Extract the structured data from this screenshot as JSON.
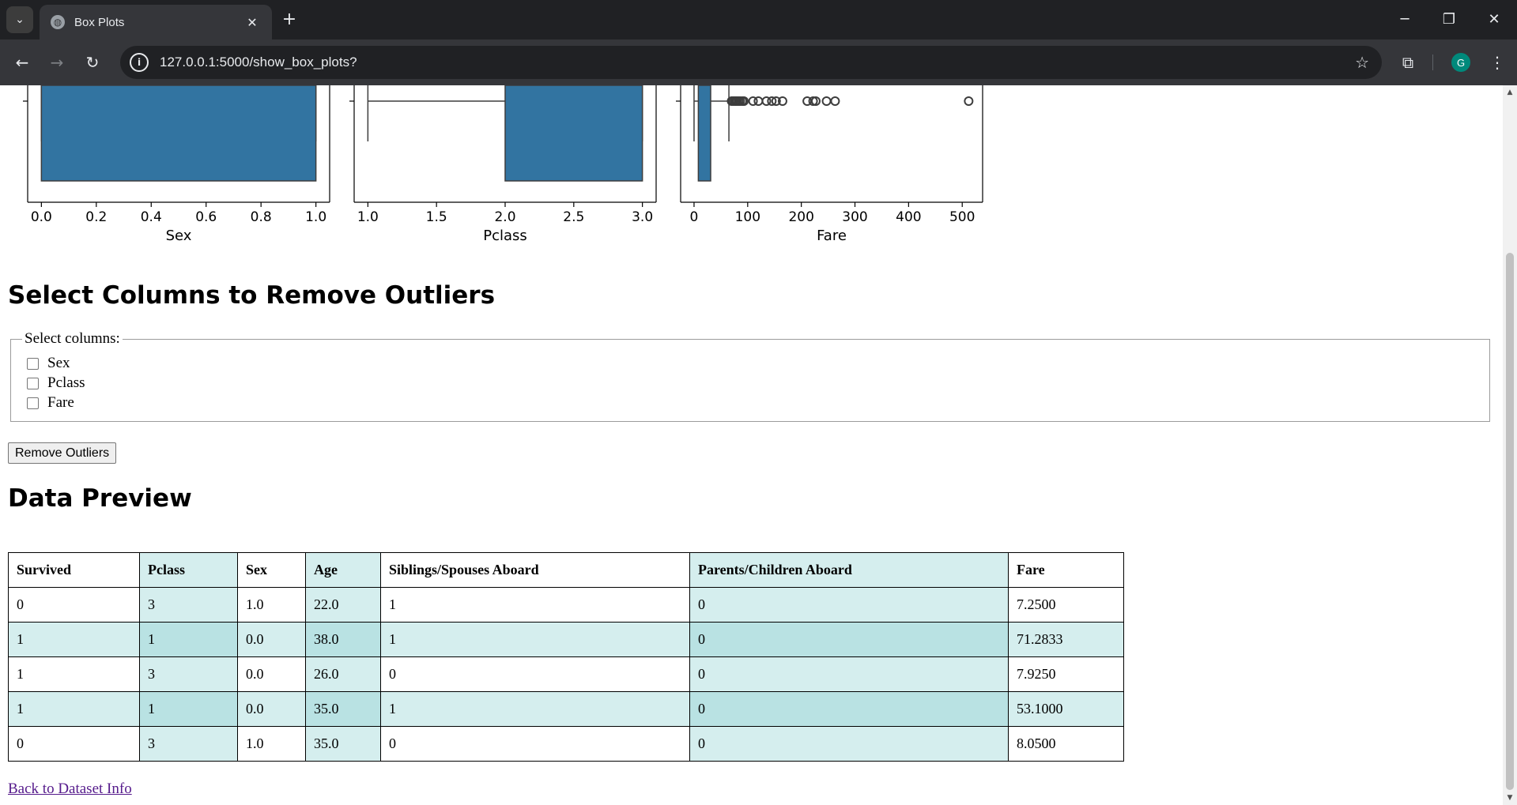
{
  "browser": {
    "tab_title": "Box Plots",
    "url": "127.0.0.1:5000/show_box_plots?",
    "profile_initial": "G"
  },
  "chart_data": [
    {
      "type": "box",
      "orientation": "horizontal",
      "xlabel": "Sex",
      "xlim": [
        -0.05,
        1.05
      ],
      "xticks": [
        "0.0",
        "0.2",
        "0.4",
        "0.6",
        "0.8",
        "1.0"
      ],
      "box": {
        "q1": 0.0,
        "q3": 1.0,
        "whisker_low": 0.0,
        "whisker_high": 1.0
      },
      "outliers": []
    },
    {
      "type": "box",
      "orientation": "horizontal",
      "xlabel": "Pclass",
      "xlim": [
        0.9,
        3.1
      ],
      "xticks": [
        "1.0",
        "1.5",
        "2.0",
        "2.5",
        "3.0"
      ],
      "box": {
        "q1": 2.0,
        "q3": 3.0,
        "whisker_low": 1.0,
        "whisker_high": 3.0
      },
      "outliers": []
    },
    {
      "type": "box",
      "orientation": "horizontal",
      "xlabel": "Fare",
      "xlim": [
        -25,
        538
      ],
      "xticks": [
        "0",
        "100",
        "200",
        "300",
        "400",
        "500"
      ],
      "box": {
        "q1": 8,
        "q3": 31,
        "whisker_low": 0,
        "whisker_high": 65
      },
      "outliers": [
        70,
        73,
        76,
        78,
        80,
        83,
        86,
        90,
        93,
        110,
        120,
        135,
        145,
        153,
        165,
        211,
        222,
        227,
        247,
        263,
        512
      ]
    }
  ],
  "outliers_section": {
    "title": "Select Columns to Remove Outliers",
    "legend": "Select columns:",
    "columns": [
      "Sex",
      "Pclass",
      "Fare"
    ],
    "button_label": "Remove Outliers"
  },
  "preview": {
    "title": "Data Preview",
    "headers": [
      "Survived",
      "Pclass",
      "Sex",
      "Age",
      "Siblings/Spouses Aboard",
      "Parents/Children Aboard",
      "Fare"
    ],
    "rows": [
      [
        "0",
        "3",
        "1.0",
        "22.0",
        "1",
        "0",
        "7.2500"
      ],
      [
        "1",
        "1",
        "0.0",
        "38.0",
        "1",
        "0",
        "71.2833"
      ],
      [
        "1",
        "3",
        "0.0",
        "26.0",
        "0",
        "0",
        "7.9250"
      ],
      [
        "1",
        "1",
        "0.0",
        "35.0",
        "1",
        "0",
        "53.1000"
      ],
      [
        "0",
        "3",
        "1.0",
        "35.0",
        "0",
        "0",
        "8.0500"
      ]
    ]
  },
  "back_link": "Back to Dataset Info",
  "colors": {
    "box_fill": "#3274a1",
    "row_alt": "#d5eeee",
    "row_alt_dark": "#b9e2e3"
  }
}
